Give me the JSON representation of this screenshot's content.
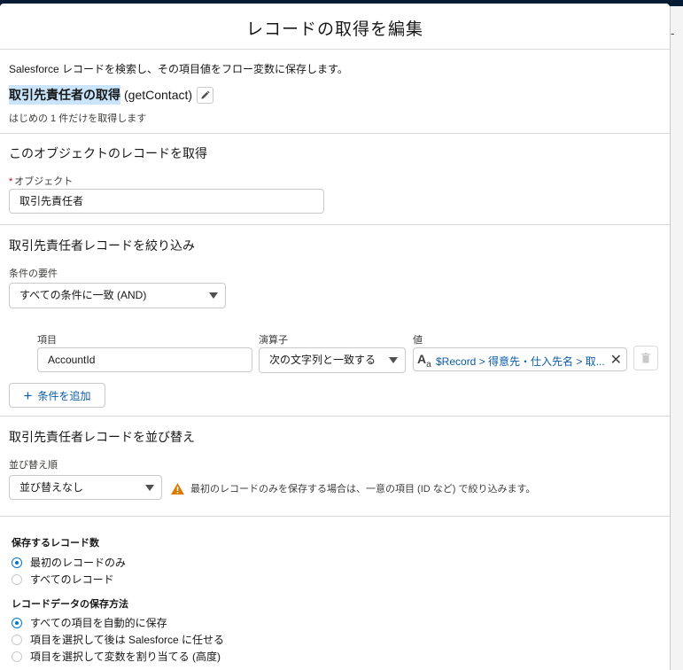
{
  "modal": {
    "title": "レコードの取得を編集"
  },
  "intro": {
    "description": "Salesforce レコードを検索し、その項目値をフロー変数に保存します。",
    "element_label": "取引先責任者の取得",
    "api_name": "(getContact)",
    "subtext": "はじめの 1 件だけを取得します"
  },
  "object_section": {
    "title": "このオブジェクトのレコードを取得",
    "required_mark": "*",
    "object_label": "オブジェクト",
    "object_value": "取引先責任者"
  },
  "filter_section": {
    "title": "取引先責任者レコードを絞り込み",
    "condition_label": "条件の要件",
    "condition_value": "すべての条件に一致 (AND)",
    "columns": {
      "field": "項目",
      "operator": "演算子",
      "value": "値"
    },
    "row": {
      "field": "AccountId",
      "operator": "次の文字列と一致する",
      "value": "$Record > 得意先・仕入先名 > 取..."
    },
    "add_condition": "条件を追加"
  },
  "sort_section": {
    "title": "取引先責任者レコードを並び替え",
    "sort_label": "並び替え順",
    "sort_value": "並び替えなし",
    "warning": "最初のレコードのみを保存する場合は、一意の項目 (ID など) で絞り込みます。"
  },
  "store_section": {
    "count_label": "保存するレコード数",
    "count_options": [
      "最初のレコードのみ",
      "すべてのレコード"
    ],
    "count_selected": 0,
    "method_label": "レコードデータの保存方法",
    "method_options": [
      "すべての項目を自動的に保存",
      "項目を選択して後は Salesforce に任せる",
      "項目を選択して変数を割り当てる (高度)"
    ],
    "method_selected": 0
  },
  "background": {
    "partial_text": "-"
  },
  "icons": {
    "edit": "pencil-icon",
    "caret": "chevron-down-icon",
    "text_type": "text-type-icon",
    "clear": "close-icon",
    "delete": "trash-icon",
    "add": "plus-icon",
    "warning": "warning-icon"
  },
  "colors": {
    "brand": "#0176d3",
    "link": "#0b5cab",
    "warning": "#dd7a01",
    "required": "#ba0517"
  }
}
